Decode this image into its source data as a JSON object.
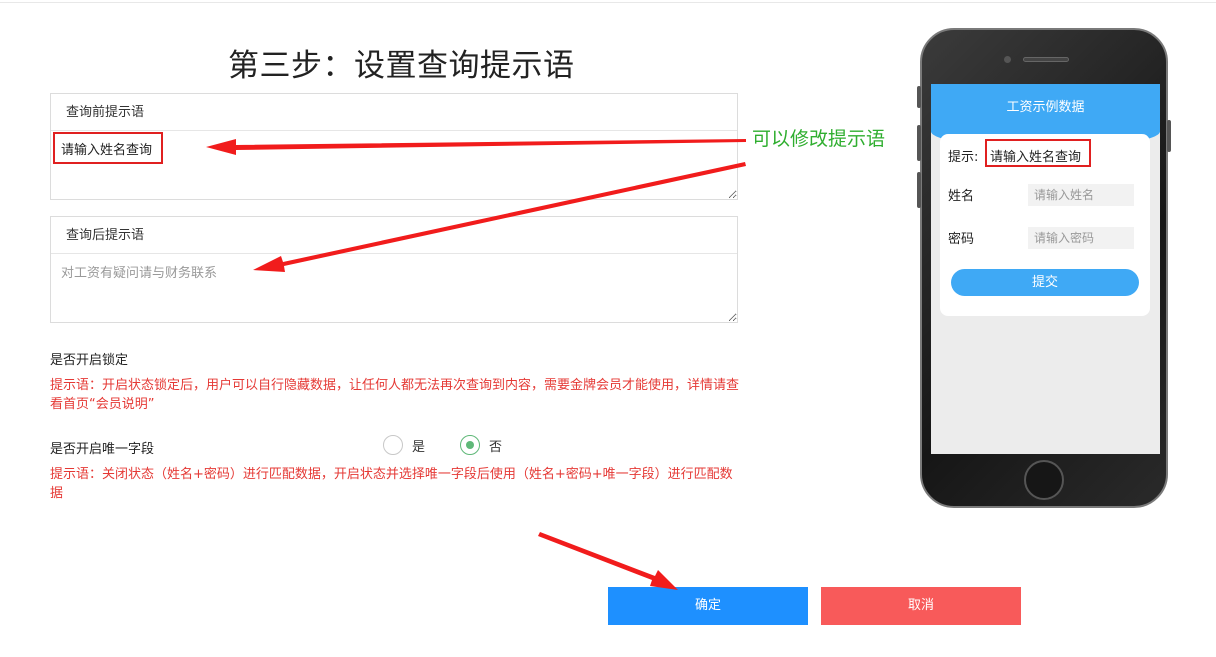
{
  "page": {
    "title": "第三步：设置查询提示语"
  },
  "before_prompt": {
    "label": "查询前提示语",
    "value": "请输入姓名查询"
  },
  "after_prompt": {
    "label": "查询后提示语",
    "placeholder": "对工资有疑问请与财务联系"
  },
  "lock": {
    "label": "是否开启锁定",
    "hint": "提示语：开启状态锁定后，用户可以自行隐藏数据，让任何人都无法再次查询到内容，需要金牌会员才能使用，详情请查看首页“会员说明”"
  },
  "unique_field": {
    "label": "是否开启唯一字段",
    "options": [
      "是",
      "否"
    ],
    "selected": "否",
    "hint": "提示语：关闭状态（姓名+密码）进行匹配数据，开启状态并选择唯一字段后使用（姓名+密码+唯一字段）进行匹配数据"
  },
  "buttons": {
    "ok": "确定",
    "cancel": "取消"
  },
  "annotation": {
    "text": "可以修改提示语"
  },
  "phone_preview": {
    "header": "工资示例数据",
    "hint_label": "提示:",
    "hint_value": "请输入姓名查询",
    "name_label": "姓名",
    "name_placeholder": "请输入姓名",
    "password_label": "密码",
    "password_placeholder": "请输入密码",
    "submit": "提交"
  },
  "colors": {
    "primary": "#1e90ff",
    "danger": "#f85a5a",
    "hint_red": "#e53935",
    "annotation_green": "#2fae2f",
    "phone_accent": "#3fa9f5"
  }
}
